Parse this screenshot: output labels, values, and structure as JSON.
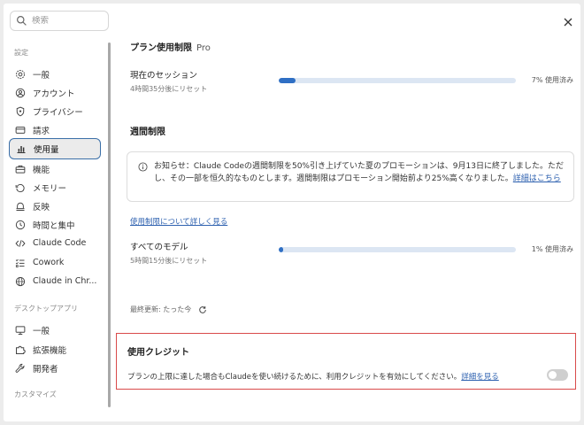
{
  "search": {
    "placeholder": "検索"
  },
  "sidebar": {
    "section_settings": "設定",
    "settings_items": [
      {
        "label": "一般",
        "icon": "gear-icon"
      },
      {
        "label": "アカウント",
        "icon": "user-circle-icon"
      },
      {
        "label": "プライバシー",
        "icon": "shield-icon"
      },
      {
        "label": "請求",
        "icon": "credit-card-icon"
      },
      {
        "label": "使用量",
        "icon": "bar-chart-icon",
        "active": true
      },
      {
        "label": "機能",
        "icon": "toolbox-icon"
      },
      {
        "label": "メモリー",
        "icon": "memory-icon"
      },
      {
        "label": "反映",
        "icon": "bell-icon"
      },
      {
        "label": "時間と集中",
        "icon": "clock-icon"
      },
      {
        "label": "Claude Code",
        "icon": "code-icon"
      },
      {
        "label": "Cowork",
        "icon": "checklist-icon"
      },
      {
        "label": "Claude in Chr...",
        "icon": "globe-icon"
      }
    ],
    "section_desktop": "デスクトップアプリ",
    "desktop_items": [
      {
        "label": "一般",
        "icon": "monitor-icon"
      },
      {
        "label": "拡張機能",
        "icon": "extension-icon"
      },
      {
        "label": "開発者",
        "icon": "wrench-icon"
      }
    ],
    "section_customize": "カスタマイズ"
  },
  "plan": {
    "title": "プラン使用制限",
    "badge": "Pro",
    "session_label": "現在のセッション",
    "session_reset": "4時間35分後にリセット",
    "session_percent_text": "7% 使用済み",
    "session_fraction": 0.07
  },
  "weekly": {
    "title": "週間制限",
    "notice_text": "お知らせ：Claude Codeの週間制限を50%引き上げていた夏のプロモーションは、9月13日に終了しました。ただし、その一部を恒久的なものとします。週間制限はプロモーション開始前より25%高くなりました。",
    "notice_link": "詳細はこちら",
    "learn_more": "使用制限について詳しく見る",
    "all_models_label": "すべてのモデル",
    "all_models_reset": "5時間15分後にリセット",
    "all_models_percent_text": "1% 使用済み",
    "all_models_fraction": 0.01
  },
  "updated": {
    "text": "最終更新: たった今"
  },
  "credits": {
    "title": "使用クレジット",
    "description": "プランの上限に達した場合もClaudeを使い続けるために、利用クレジットを有効にしてください。",
    "link": "詳細を見る",
    "toggle_on": false
  },
  "colors": {
    "accent": "#2f6fc4",
    "highlight_border": "#d94a4a",
    "active_border": "#3b6fa8"
  }
}
